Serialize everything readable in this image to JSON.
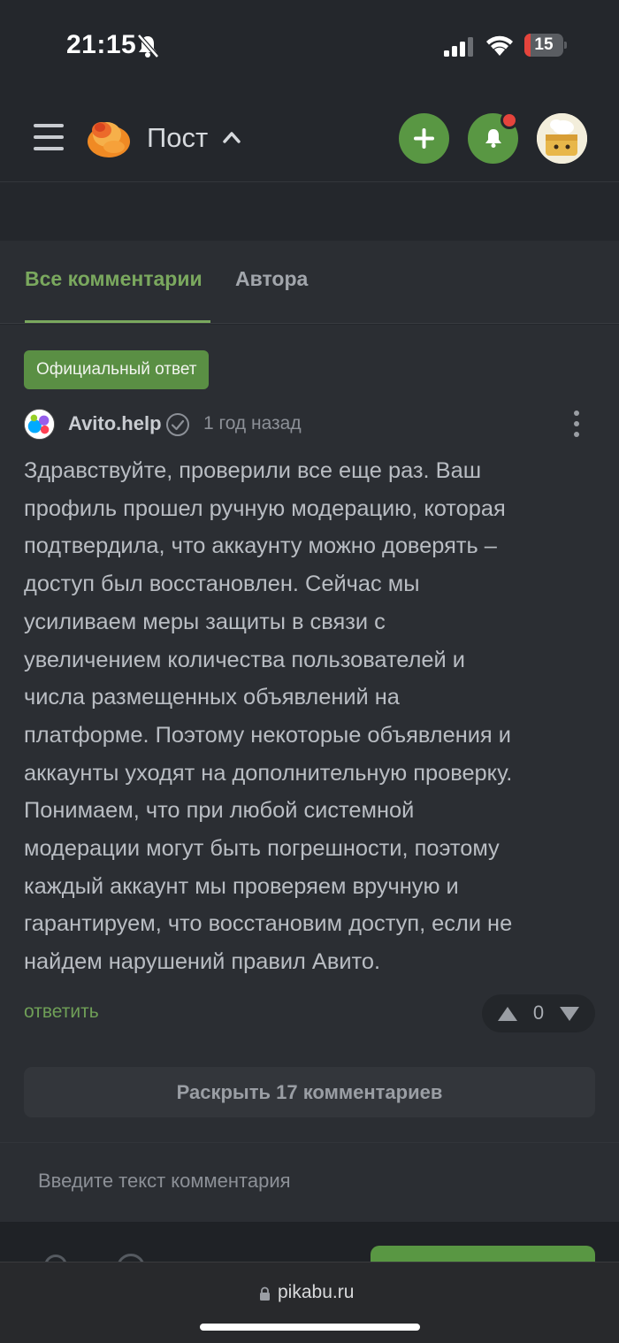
{
  "status_bar": {
    "time": "21:15",
    "battery_level": "15",
    "battery_fraction": 0.15
  },
  "header": {
    "title": "Пост",
    "icons": {
      "menu": "hamburger-menu-icon",
      "logo": "pikabu-logo",
      "add": "plus-icon",
      "notifications": "bell-icon",
      "avatar": "user-avatar"
    },
    "notification_dot_color": "#e5443c"
  },
  "tabs": {
    "all": "Все комментарии",
    "author": "Автора",
    "active": "all"
  },
  "comment": {
    "badge": "Официальный ответ",
    "author": "Avito.help",
    "verified": true,
    "time": "1 год назад",
    "text": "Здравствуйте, проверили все еще раз. Ваш\nпрофиль прошел ручную модерацию, которая\nподтвердила, что аккаунту можно доверять –\nдоступ был восстановлен. Сейчас мы\nусиливаем меры защиты в связи с\nувеличением количества пользователей и\nчисла размещенных объявлений на\nплатформе. Поэтому некоторые объявления и\nаккаунты уходят на дополнительную проверку.\nПонимаем, что при любой системной\nмодерации могут быть погрешности, поэтому\nкаждый аккаунт мы проверяем вручную и\nгарантируем, что восстановим доступ, если не\nнайдем нарушений правил Авито.",
    "reply_label": "ответить",
    "rating": "0",
    "expand_label": "Раскрыть 17 комментариев"
  },
  "comment_input": {
    "placeholder": "Введите текст комментария",
    "value": ""
  },
  "browser": {
    "url": "pikabu.ru"
  },
  "colors": {
    "accent_green": "#599743",
    "tab_active": "#7aa85e",
    "background": "#24272c",
    "panel": "#2b2e33"
  }
}
